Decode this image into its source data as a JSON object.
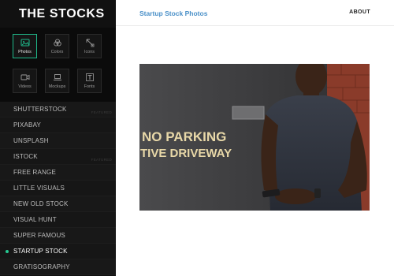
{
  "brand": {
    "title": "THE STOCKS"
  },
  "categories": [
    {
      "label": "Photos",
      "icon": "photo-icon",
      "active": true
    },
    {
      "label": "Colors",
      "icon": "palette-icon",
      "active": false
    },
    {
      "label": "Icons",
      "icon": "pen-tool-icon",
      "active": false
    },
    {
      "label": "Videos",
      "icon": "video-icon",
      "active": false
    },
    {
      "label": "Mockups",
      "icon": "laptop-icon",
      "active": false
    },
    {
      "label": "Fonts",
      "icon": "font-icon",
      "active": false
    }
  ],
  "sources": [
    {
      "label": "SHUTTERSTOCK",
      "badge": "FEATURED"
    },
    {
      "label": "PIXABAY",
      "badge": ""
    },
    {
      "label": "UNSPLASH",
      "badge": ""
    },
    {
      "label": "ISTOCK",
      "badge": "FEATURED"
    },
    {
      "label": "FREE RANGE",
      "badge": ""
    },
    {
      "label": "LITTLE VISUALS",
      "badge": ""
    },
    {
      "label": "NEW OLD STOCK",
      "badge": ""
    },
    {
      "label": "VISUAL HUNT",
      "badge": ""
    },
    {
      "label": "SUPER FAMOUS",
      "badge": ""
    },
    {
      "label": "STARTUP STOCK",
      "badge": "",
      "active": true
    },
    {
      "label": "GRATISOGRAPHY",
      "badge": ""
    }
  ],
  "header": {
    "title": "Startup Stock Photos",
    "about": "ABOUT"
  },
  "photo": {
    "sign_line1": "NO PARKING",
    "sign_line2": "TIVE DRIVEWAY"
  },
  "colors": {
    "accent": "#1fb98a",
    "title_blue": "#4a90c8",
    "sidebar_bg": "#111111"
  }
}
